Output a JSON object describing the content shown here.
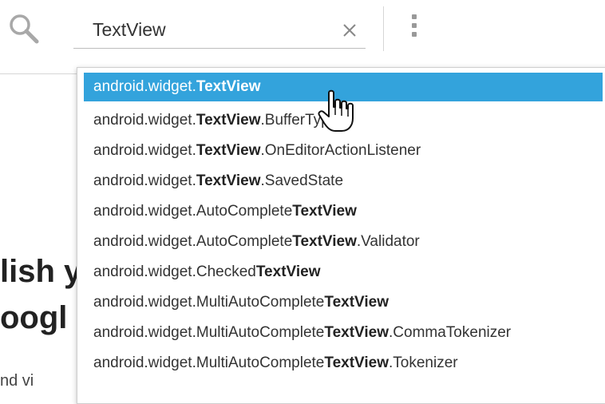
{
  "search": {
    "value": "TextView"
  },
  "background_text": {
    "line1": "lish y",
    "line2": "oogl",
    "line3": "nd vi"
  },
  "suggestions": [
    {
      "prefix": "android.widget.",
      "match": "TextView",
      "suffix": ""
    },
    {
      "prefix": "android.widget.",
      "match": "TextView",
      "suffix": ".BufferType"
    },
    {
      "prefix": "android.widget.",
      "match": "TextView",
      "suffix": ".OnEditorActionListener"
    },
    {
      "prefix": "android.widget.",
      "match": "TextView",
      "suffix": ".SavedState"
    },
    {
      "prefix": "android.widget.AutoComplete",
      "match": "TextView",
      "suffix": ""
    },
    {
      "prefix": "android.widget.AutoComplete",
      "match": "TextView",
      "suffix": ".Validator"
    },
    {
      "prefix": "android.widget.Checked",
      "match": "TextView",
      "suffix": ""
    },
    {
      "prefix": "android.widget.MultiAutoComplete",
      "match": "TextView",
      "suffix": ""
    },
    {
      "prefix": "android.widget.MultiAutoComplete",
      "match": "TextView",
      "suffix": ".CommaTokenizer"
    },
    {
      "prefix": "android.widget.MultiAutoComplete",
      "match": "TextView",
      "suffix": ".Tokenizer"
    }
  ],
  "selected_index": 0,
  "colors": {
    "highlight": "#33a3dc"
  },
  "icons": {
    "search": "search-icon",
    "clear": "close-icon",
    "menu": "more-vert-icon",
    "cursor": "hand-pointer-icon"
  }
}
